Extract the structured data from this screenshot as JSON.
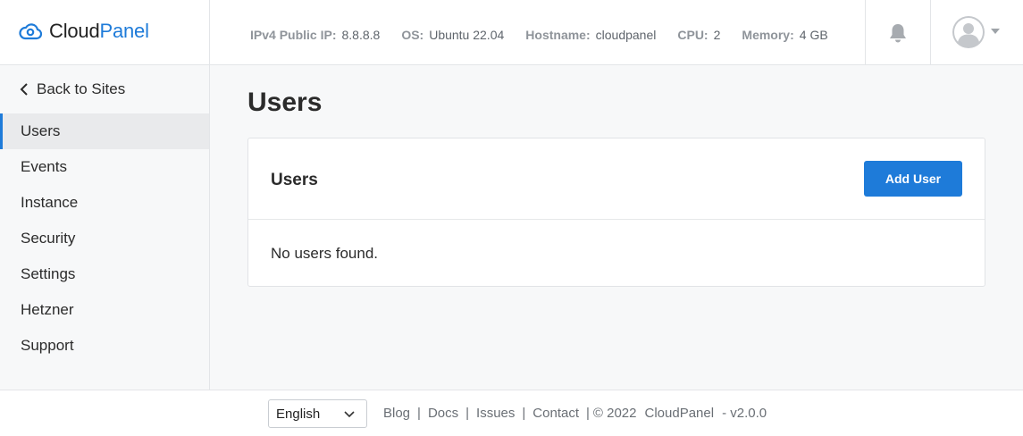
{
  "brand": {
    "part1": "Cloud",
    "part2": "Panel",
    "accent": "#1e7bd9"
  },
  "sysinfo": [
    {
      "key": "IPv4 Public IP:",
      "value": "8.8.8.8"
    },
    {
      "key": "OS:",
      "value": "Ubuntu 22.04"
    },
    {
      "key": "Hostname:",
      "value": "cloudpanel"
    },
    {
      "key": "CPU:",
      "value": "2"
    },
    {
      "key": "Memory:",
      "value": "4 GB"
    }
  ],
  "header": {
    "notification_icon": "bell-icon",
    "avatar_icon": "user-avatar-icon"
  },
  "sidebar": {
    "back_label": "Back to Sites",
    "items": [
      {
        "label": "Users",
        "active": true
      },
      {
        "label": "Events"
      },
      {
        "label": "Instance"
      },
      {
        "label": "Security"
      },
      {
        "label": "Settings"
      },
      {
        "label": "Hetzner"
      },
      {
        "label": "Support"
      }
    ]
  },
  "main": {
    "page_title": "Users",
    "card": {
      "title": "Users",
      "add_button": "Add User",
      "empty_text": "No users found."
    }
  },
  "footer": {
    "language": "English",
    "links": [
      "Blog",
      "Docs",
      "Issues",
      "Contact"
    ],
    "copyright": "© 2022",
    "product": "CloudPanel",
    "version": "- v2.0.0"
  }
}
